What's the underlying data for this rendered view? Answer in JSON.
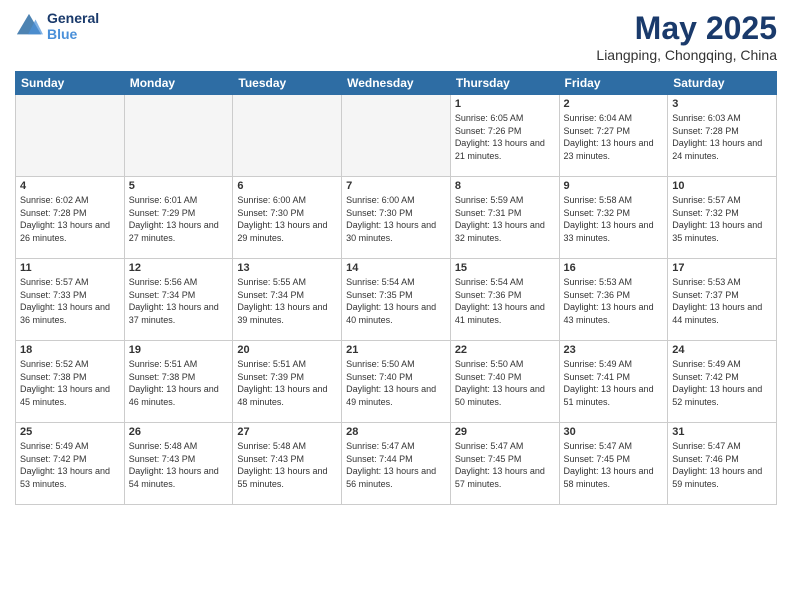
{
  "header": {
    "logo_general": "General",
    "logo_blue": "Blue",
    "title": "May 2025",
    "subtitle": "Liangping, Chongqing, China"
  },
  "weekdays": [
    "Sunday",
    "Monday",
    "Tuesday",
    "Wednesday",
    "Thursday",
    "Friday",
    "Saturday"
  ],
  "weeks": [
    [
      {
        "day": "",
        "empty": true
      },
      {
        "day": "",
        "empty": true
      },
      {
        "day": "",
        "empty": true
      },
      {
        "day": "",
        "empty": true
      },
      {
        "day": "1",
        "sunrise": "Sunrise: 6:05 AM",
        "sunset": "Sunset: 7:26 PM",
        "daylight": "Daylight: 13 hours and 21 minutes."
      },
      {
        "day": "2",
        "sunrise": "Sunrise: 6:04 AM",
        "sunset": "Sunset: 7:27 PM",
        "daylight": "Daylight: 13 hours and 23 minutes."
      },
      {
        "day": "3",
        "sunrise": "Sunrise: 6:03 AM",
        "sunset": "Sunset: 7:28 PM",
        "daylight": "Daylight: 13 hours and 24 minutes."
      }
    ],
    [
      {
        "day": "4",
        "sunrise": "Sunrise: 6:02 AM",
        "sunset": "Sunset: 7:28 PM",
        "daylight": "Daylight: 13 hours and 26 minutes."
      },
      {
        "day": "5",
        "sunrise": "Sunrise: 6:01 AM",
        "sunset": "Sunset: 7:29 PM",
        "daylight": "Daylight: 13 hours and 27 minutes."
      },
      {
        "day": "6",
        "sunrise": "Sunrise: 6:00 AM",
        "sunset": "Sunset: 7:30 PM",
        "daylight": "Daylight: 13 hours and 29 minutes."
      },
      {
        "day": "7",
        "sunrise": "Sunrise: 6:00 AM",
        "sunset": "Sunset: 7:30 PM",
        "daylight": "Daylight: 13 hours and 30 minutes."
      },
      {
        "day": "8",
        "sunrise": "Sunrise: 5:59 AM",
        "sunset": "Sunset: 7:31 PM",
        "daylight": "Daylight: 13 hours and 32 minutes."
      },
      {
        "day": "9",
        "sunrise": "Sunrise: 5:58 AM",
        "sunset": "Sunset: 7:32 PM",
        "daylight": "Daylight: 13 hours and 33 minutes."
      },
      {
        "day": "10",
        "sunrise": "Sunrise: 5:57 AM",
        "sunset": "Sunset: 7:32 PM",
        "daylight": "Daylight: 13 hours and 35 minutes."
      }
    ],
    [
      {
        "day": "11",
        "sunrise": "Sunrise: 5:57 AM",
        "sunset": "Sunset: 7:33 PM",
        "daylight": "Daylight: 13 hours and 36 minutes."
      },
      {
        "day": "12",
        "sunrise": "Sunrise: 5:56 AM",
        "sunset": "Sunset: 7:34 PM",
        "daylight": "Daylight: 13 hours and 37 minutes."
      },
      {
        "day": "13",
        "sunrise": "Sunrise: 5:55 AM",
        "sunset": "Sunset: 7:34 PM",
        "daylight": "Daylight: 13 hours and 39 minutes."
      },
      {
        "day": "14",
        "sunrise": "Sunrise: 5:54 AM",
        "sunset": "Sunset: 7:35 PM",
        "daylight": "Daylight: 13 hours and 40 minutes."
      },
      {
        "day": "15",
        "sunrise": "Sunrise: 5:54 AM",
        "sunset": "Sunset: 7:36 PM",
        "daylight": "Daylight: 13 hours and 41 minutes."
      },
      {
        "day": "16",
        "sunrise": "Sunrise: 5:53 AM",
        "sunset": "Sunset: 7:36 PM",
        "daylight": "Daylight: 13 hours and 43 minutes."
      },
      {
        "day": "17",
        "sunrise": "Sunrise: 5:53 AM",
        "sunset": "Sunset: 7:37 PM",
        "daylight": "Daylight: 13 hours and 44 minutes."
      }
    ],
    [
      {
        "day": "18",
        "sunrise": "Sunrise: 5:52 AM",
        "sunset": "Sunset: 7:38 PM",
        "daylight": "Daylight: 13 hours and 45 minutes."
      },
      {
        "day": "19",
        "sunrise": "Sunrise: 5:51 AM",
        "sunset": "Sunset: 7:38 PM",
        "daylight": "Daylight: 13 hours and 46 minutes."
      },
      {
        "day": "20",
        "sunrise": "Sunrise: 5:51 AM",
        "sunset": "Sunset: 7:39 PM",
        "daylight": "Daylight: 13 hours and 48 minutes."
      },
      {
        "day": "21",
        "sunrise": "Sunrise: 5:50 AM",
        "sunset": "Sunset: 7:40 PM",
        "daylight": "Daylight: 13 hours and 49 minutes."
      },
      {
        "day": "22",
        "sunrise": "Sunrise: 5:50 AM",
        "sunset": "Sunset: 7:40 PM",
        "daylight": "Daylight: 13 hours and 50 minutes."
      },
      {
        "day": "23",
        "sunrise": "Sunrise: 5:49 AM",
        "sunset": "Sunset: 7:41 PM",
        "daylight": "Daylight: 13 hours and 51 minutes."
      },
      {
        "day": "24",
        "sunrise": "Sunrise: 5:49 AM",
        "sunset": "Sunset: 7:42 PM",
        "daylight": "Daylight: 13 hours and 52 minutes."
      }
    ],
    [
      {
        "day": "25",
        "sunrise": "Sunrise: 5:49 AM",
        "sunset": "Sunset: 7:42 PM",
        "daylight": "Daylight: 13 hours and 53 minutes."
      },
      {
        "day": "26",
        "sunrise": "Sunrise: 5:48 AM",
        "sunset": "Sunset: 7:43 PM",
        "daylight": "Daylight: 13 hours and 54 minutes."
      },
      {
        "day": "27",
        "sunrise": "Sunrise: 5:48 AM",
        "sunset": "Sunset: 7:43 PM",
        "daylight": "Daylight: 13 hours and 55 minutes."
      },
      {
        "day": "28",
        "sunrise": "Sunrise: 5:47 AM",
        "sunset": "Sunset: 7:44 PM",
        "daylight": "Daylight: 13 hours and 56 minutes."
      },
      {
        "day": "29",
        "sunrise": "Sunrise: 5:47 AM",
        "sunset": "Sunset: 7:45 PM",
        "daylight": "Daylight: 13 hours and 57 minutes."
      },
      {
        "day": "30",
        "sunrise": "Sunrise: 5:47 AM",
        "sunset": "Sunset: 7:45 PM",
        "daylight": "Daylight: 13 hours and 58 minutes."
      },
      {
        "day": "31",
        "sunrise": "Sunrise: 5:47 AM",
        "sunset": "Sunset: 7:46 PM",
        "daylight": "Daylight: 13 hours and 59 minutes."
      }
    ]
  ]
}
